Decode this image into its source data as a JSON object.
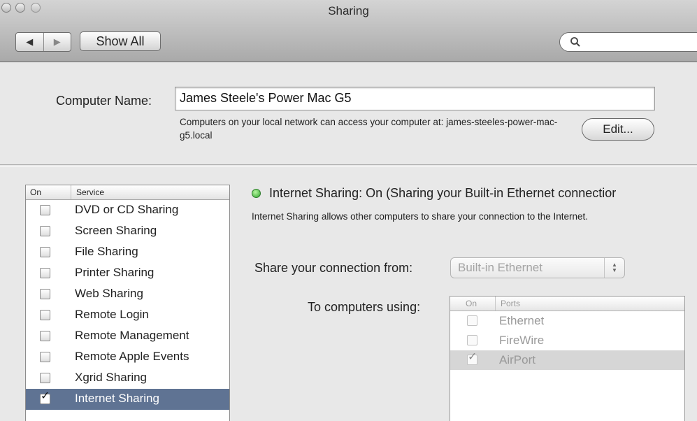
{
  "window": {
    "title": "Sharing"
  },
  "toolbar": {
    "back_glyph": "◀",
    "forward_glyph": "▶",
    "show_all_label": "Show All",
    "search_placeholder": ""
  },
  "computer_name": {
    "label": "Computer Name:",
    "value": "James Steele's Power Mac G5",
    "description": "Computers on your local network can access your computer at: james-steeles-power-mac-g5.local",
    "edit_label": "Edit..."
  },
  "services": {
    "header_on": "On",
    "header_service": "Service",
    "items": [
      {
        "label": "DVD or CD Sharing",
        "checked": false,
        "selected": false
      },
      {
        "label": "Screen Sharing",
        "checked": false,
        "selected": false
      },
      {
        "label": "File Sharing",
        "checked": false,
        "selected": false
      },
      {
        "label": "Printer Sharing",
        "checked": false,
        "selected": false
      },
      {
        "label": "Web Sharing",
        "checked": false,
        "selected": false
      },
      {
        "label": "Remote Login",
        "checked": false,
        "selected": false
      },
      {
        "label": "Remote Management",
        "checked": false,
        "selected": false
      },
      {
        "label": "Remote Apple Events",
        "checked": false,
        "selected": false
      },
      {
        "label": "Xgrid Sharing",
        "checked": false,
        "selected": false
      },
      {
        "label": "Internet Sharing",
        "checked": true,
        "selected": true
      }
    ]
  },
  "detail": {
    "status_text": "Internet Sharing: On (Sharing your Built-in Ethernet connectior",
    "status_color": "#2fa52c",
    "description": "Internet Sharing allows other computers to share your connection to the Internet.",
    "share_from_label": "Share your connection from:",
    "share_from_value": "Built-in Ethernet",
    "to_computers_label": "To computers using:",
    "ports_header_on": "On",
    "ports_header_ports": "Ports",
    "ports": [
      {
        "label": "Ethernet",
        "checked": false,
        "selected": false
      },
      {
        "label": "FireWire",
        "checked": false,
        "selected": false
      },
      {
        "label": "AirPort",
        "checked": true,
        "selected": true
      }
    ]
  },
  "colors": {
    "selection": "#5f7393",
    "accent_green": "#2fa52c"
  }
}
